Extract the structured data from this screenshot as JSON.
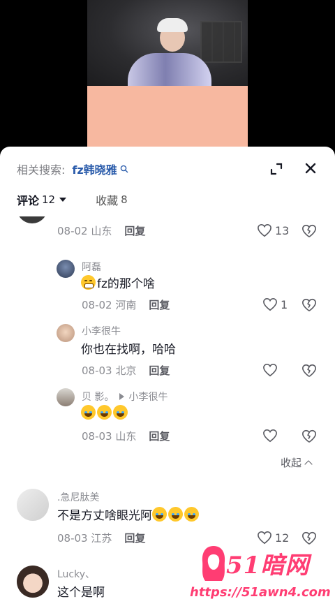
{
  "header": {
    "related_label": "相关搜索:",
    "related_keyword": "fz韩晓雅"
  },
  "tabs": {
    "comments_label": "评论",
    "comments_count": "12",
    "favorites_label": "收藏",
    "favorites_count": "8"
  },
  "comments": [
    {
      "meta_date": "08-02 山东",
      "reply_label": "回复",
      "likes": "13"
    },
    {
      "user": "阿磊",
      "text": "fz的那个啥",
      "meta_date": "08-02 河南",
      "reply_label": "回复",
      "likes": "1"
    },
    {
      "user": "小李很牛",
      "text": "你也在找啊，哈哈",
      "meta_date": "08-03 北京",
      "reply_label": "回复",
      "likes": ""
    },
    {
      "user": "贝 影。",
      "reply_to": "小李很牛",
      "meta_date": "08-03 山东",
      "reply_label": "回复",
      "likes": ""
    },
    {
      "user": ".急尼肽美",
      "text": "不是方丈啥眼光阿",
      "meta_date": "08-03 江苏",
      "reply_label": "回复",
      "likes": "12"
    },
    {
      "user": "Lucky、",
      "text": "这个是啊"
    }
  ],
  "collapse_label": "收起",
  "watermark": {
    "title": "51暗网",
    "url": "https://51awn4.com"
  },
  "colors": {
    "accent_link": "#2b5cab",
    "watermark": "#ff3d73",
    "muted_text": "#8a8b91"
  }
}
